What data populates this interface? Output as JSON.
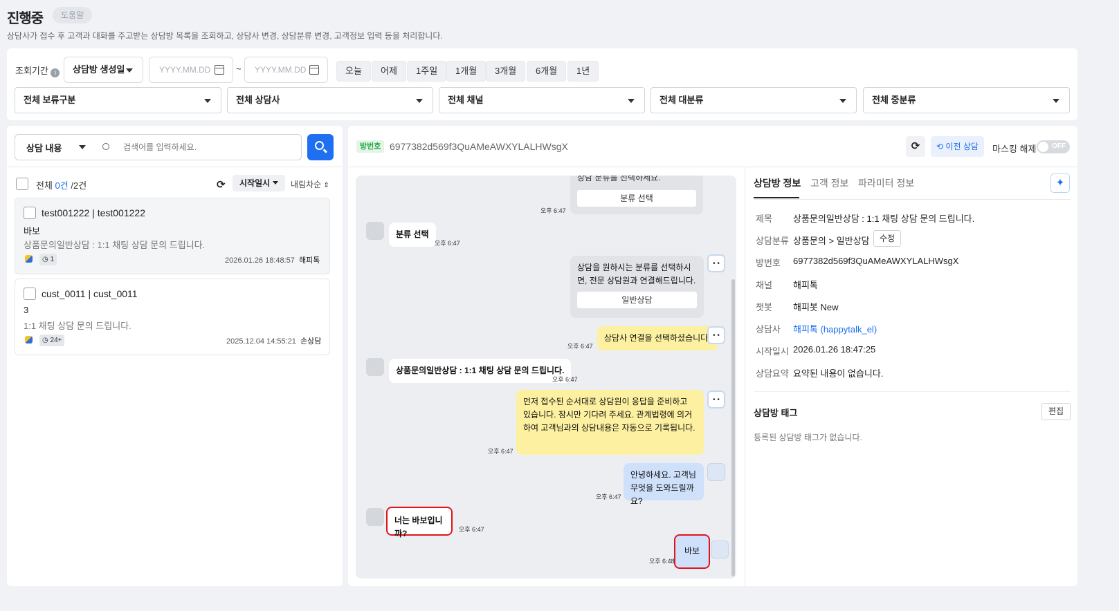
{
  "header": {
    "title": "진행중",
    "help_label": "도움말",
    "description": "상담사가 접수 후 고객과 대화를 주고받는 상담방 목록을 조회하고, 상담사 변경, 상담분류 변경, 고객정보 입력 등을 처리합니다."
  },
  "filters": {
    "period_label": "조회기간",
    "date_type": "상담방 생성일",
    "date_placeholder": "YYYY.MM.DD",
    "tilde": "~",
    "quick": [
      "오늘",
      "어제",
      "1주일",
      "1개월",
      "3개월",
      "6개월",
      "1년"
    ],
    "selects": [
      "전체 보류구분",
      "전체 상담사",
      "전체 채널",
      "전체 대분류",
      "전체 중분류"
    ]
  },
  "list": {
    "search_type": "상담 내용",
    "search_placeholder": "검색어를 입력하세요.",
    "all_label": "전체",
    "count_sel": "0건",
    "count_sep": "/",
    "count_total": "2건",
    "sort_field": "시작일시",
    "sort_order": "내림차순",
    "items": [
      {
        "title": "test001222 | test001222",
        "last_msg": "바보",
        "category": "상품문의일반상담 : 1:1 채팅 상담 문의 드립니다.",
        "badge": "1",
        "date": "2026.01.26 18:48:57",
        "agent": "해피톡"
      },
      {
        "title": "cust_0011 | cust_0011",
        "last_msg": "3",
        "category": "1:1 채팅 상담 문의 드립니다.",
        "badge": "24+",
        "date": "2025.12.04 14:55:21",
        "agent": "손상담"
      }
    ]
  },
  "room": {
    "room_badge": "방번호",
    "room_id": "6977382d569f3QuAMeAWXYLALHWsgX",
    "prev_label": "이전 상담",
    "mask_label": "마스킹 해제",
    "toggle_label": "OFF"
  },
  "chat": {
    "m1_partial": "상담 분류를 선택하세요.",
    "m1_option": "분류 선택",
    "m1_time": "오후 6:47",
    "m2_text": "분류 선택",
    "m2_time": "오후 6:47",
    "m3_text": "상담을 원하시는 분류를 선택하시면, 전문 상담원과 연결해드립니다.",
    "m3_option": "일반상담",
    "m4_text": "상담사 연결을 선택하셨습니다.",
    "m4_time": "오후 6:47",
    "m5_text": "상품문의일반상담 : 1:1 채팅 상담 문의 드립니다.",
    "m5_time": "오후 6:47",
    "m6_text": "먼저 접수된 순서대로 상담원이 응답을 준비하고 있습니다. 잠시만 기다려 주세요. 관계법령에 의거하여 고객님과의 상담내용은 자동으로 기록됩니다.",
    "m6_time": "오후 6:47",
    "m7_text": "안녕하세요. 고객님 무엇을 도와드릴까요?",
    "m7_time": "오후 6:47",
    "m8_text": "너는 바보입니까?",
    "m8_time": "오후 6:47",
    "m9_text": "바보",
    "m9_time": "오후 6:48"
  },
  "info": {
    "tabs": [
      "상담방 정보",
      "고객 정보",
      "파라미터 정보"
    ],
    "rows": {
      "subject_l": "제목",
      "subject_v": "상품문의일반상담 : 1:1 채팅 상담 문의 드립니다.",
      "cat_l": "상담분류",
      "cat_v": "상품문의 > 일반상담",
      "cat_edit": "수정",
      "room_l": "방번호",
      "room_v": "6977382d569f3QuAMeAWXYLALHWsgX",
      "channel_l": "채널",
      "channel_v": "해피톡",
      "bot_l": "챗봇",
      "bot_v": "해피봇 New",
      "agent_l": "상담사",
      "agent_v": "해피톡 (happytalk_el)",
      "start_l": "시작일시",
      "start_v": "2026.01.26 18:47:25",
      "summary_l": "상담요약",
      "summary_v": "요약된 내용이 없습니다."
    },
    "tag_title": "상담방 태그",
    "tag_edit": "편집",
    "tag_empty": "등록된 상담방 태그가 없습니다."
  },
  "colors": {
    "accent": "#1e6ff1",
    "bot_bubble": "#fdf0a0",
    "agent_bubble": "#cfe0fb",
    "highlight": "#e0141e"
  }
}
